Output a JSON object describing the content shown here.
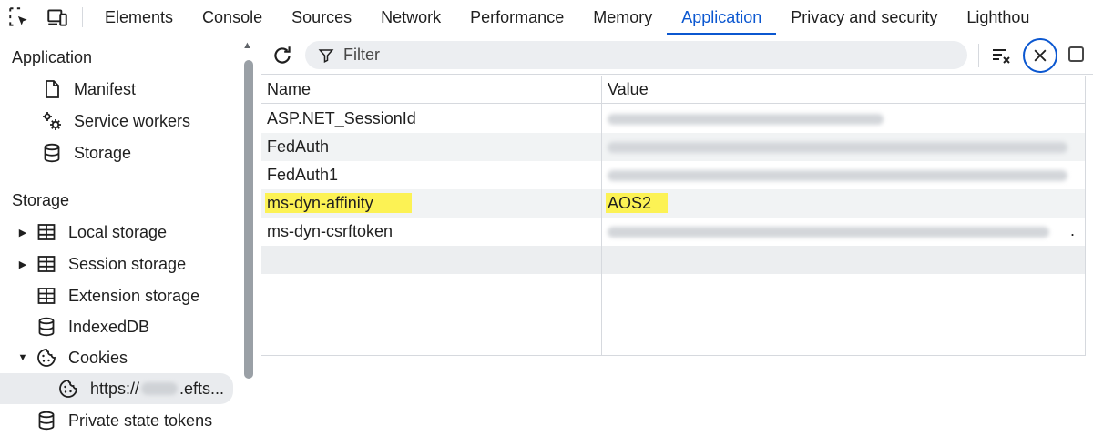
{
  "topbar": {
    "tabs": [
      {
        "label": "Elements"
      },
      {
        "label": "Console"
      },
      {
        "label": "Sources"
      },
      {
        "label": "Network"
      },
      {
        "label": "Performance"
      },
      {
        "label": "Memory"
      },
      {
        "label": "Application",
        "active": true
      },
      {
        "label": "Privacy and security"
      },
      {
        "label": "Lighthou"
      }
    ]
  },
  "sidebar": {
    "application_header": "Application",
    "application_items": [
      {
        "label": "Manifest",
        "icon": "document-icon"
      },
      {
        "label": "Service workers",
        "icon": "gears-icon"
      },
      {
        "label": "Storage",
        "icon": "database-icon"
      }
    ],
    "storage_header": "Storage",
    "storage_items": [
      {
        "label": "Local storage",
        "icon": "table-icon",
        "arrow": "▶"
      },
      {
        "label": "Session storage",
        "icon": "table-icon",
        "arrow": "▶"
      },
      {
        "label": "Extension storage",
        "icon": "table-icon",
        "arrow": ""
      },
      {
        "label": "IndexedDB",
        "icon": "database-icon",
        "arrow": ""
      },
      {
        "label": "Cookies",
        "icon": "cookie-icon",
        "arrow": "▼"
      },
      {
        "label_prefix": "https://",
        "label_suffix": ".efts...",
        "icon": "cookie-icon",
        "selected": true
      },
      {
        "label": "Private state tokens",
        "icon": "database-icon",
        "arrow": ""
      }
    ]
  },
  "toolbar": {
    "filter_placeholder": "Filter"
  },
  "table": {
    "columns": {
      "name": "Name",
      "value": "Value"
    },
    "rows": [
      {
        "name": "ASP.NET_SessionId",
        "value": "",
        "blurred": true,
        "blur_width_pct": 60
      },
      {
        "name": "FedAuth",
        "value": "",
        "blurred": true,
        "blur_width_pct": 100
      },
      {
        "name": "FedAuth1",
        "value": "",
        "blurred": true,
        "blur_width_pct": 100
      },
      {
        "name": "ms-dyn-affinity",
        "value": "AOS2",
        "highlighted": true
      },
      {
        "name": "ms-dyn-csrftoken",
        "value": "",
        "blurred": true,
        "blur_width_pct": 96,
        "trailing": "."
      }
    ]
  },
  "colors": {
    "accent": "#0b57d0",
    "highlight": "#fcf254"
  }
}
